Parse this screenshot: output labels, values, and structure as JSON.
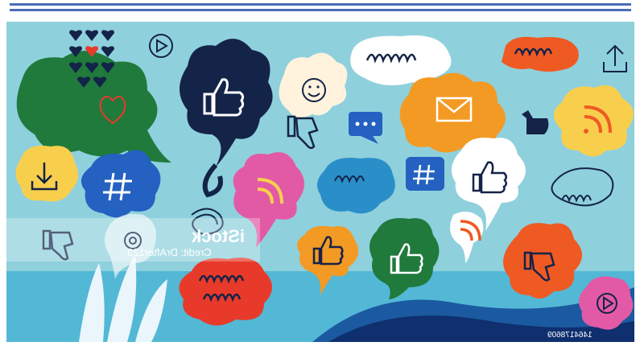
{
  "colors": {
    "rule": "#4a6bb8",
    "sky": "#8fd0dd",
    "navy": "#142348",
    "green": "#1f7a3c",
    "orange": "#f39a24",
    "red": "#e83a2a",
    "pink": "#e25aa6",
    "blue": "#2461c0",
    "yellow": "#f8cf4c",
    "cream": "#fff3dd"
  },
  "watermark": {
    "title": "iStock",
    "credit": "Credit: DrAfter123",
    "image_id": "1464178609"
  },
  "icons": [
    "hearts-icon",
    "play-icon",
    "share-icon",
    "thumbs-up-icon",
    "thumbs-down-icon",
    "hashtag-icon",
    "rss-icon",
    "mail-icon",
    "smiley-icon",
    "download-icon",
    "chat-dots-icon",
    "at-sign-icon"
  ]
}
